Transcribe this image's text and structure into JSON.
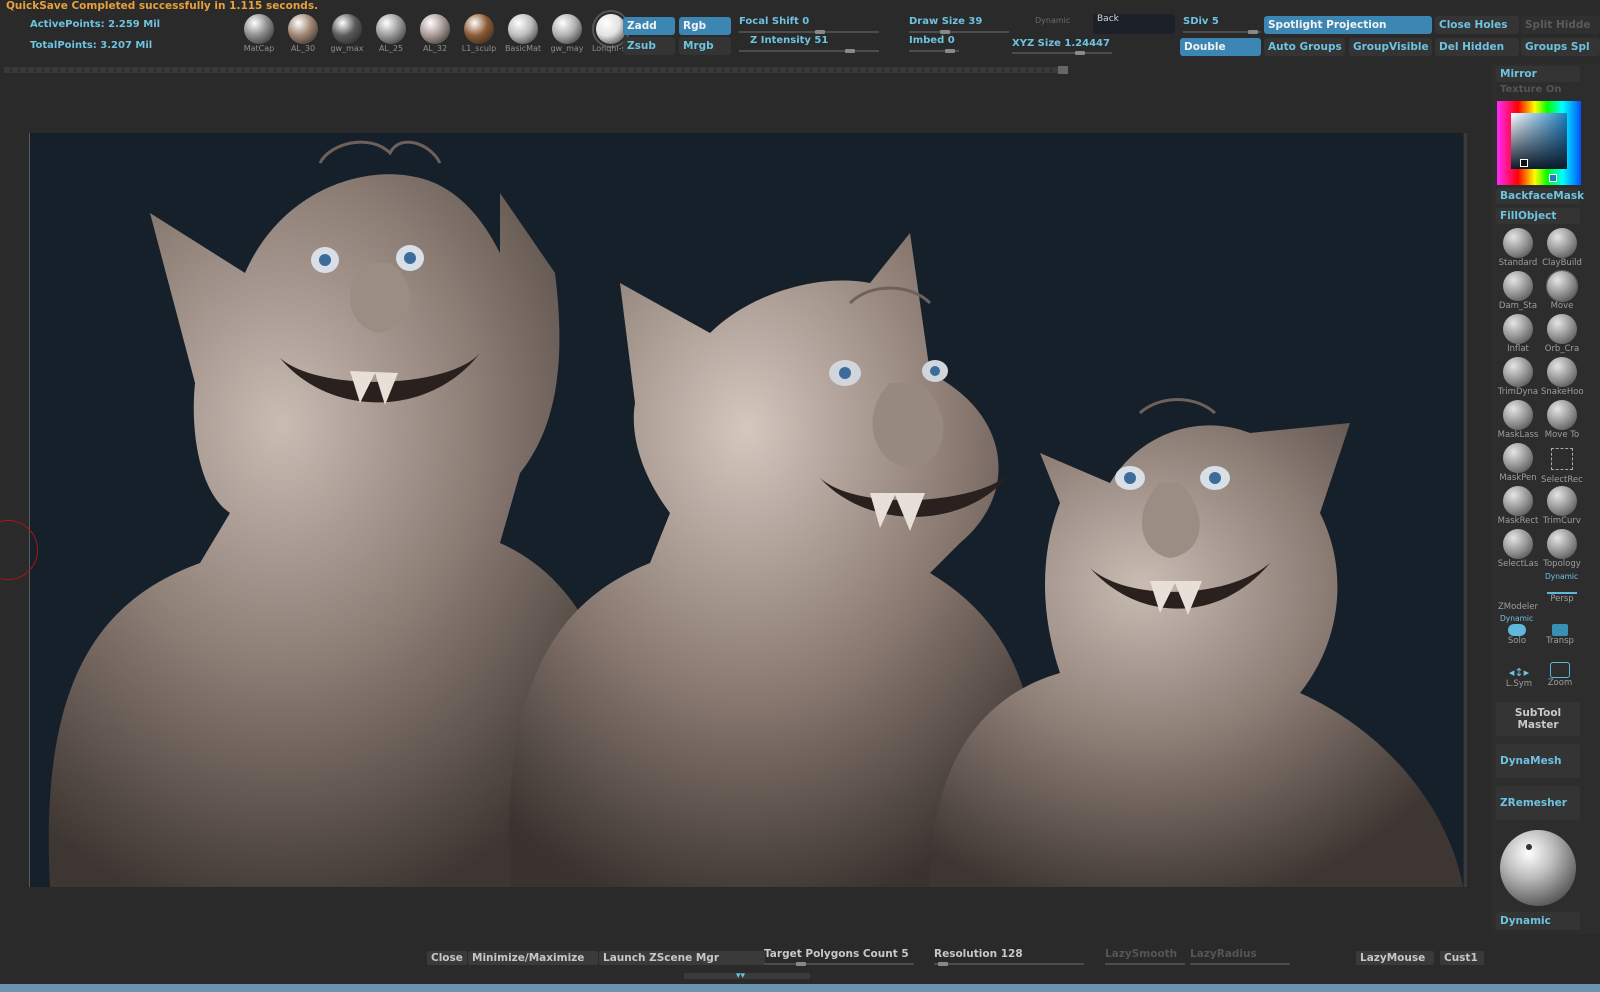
{
  "status": {
    "message": "QuickSave Completed successfully in 1.115 seconds.",
    "active_points": "ActivePoints: 2.259 Mil",
    "total_points": "TotalPoints: 3.207 Mil"
  },
  "materials": [
    {
      "label": "MatCap",
      "color": "#8c8c8c"
    },
    {
      "label": "AL_30",
      "color": "#a08470"
    },
    {
      "label": "gw_max",
      "color": "#5a5a5a"
    },
    {
      "label": "AL_25",
      "color": "#9a9a9a"
    },
    {
      "label": "AL_32",
      "color": "#a89a94"
    },
    {
      "label": "L1_sculp",
      "color": "#8b5a33"
    },
    {
      "label": "BasicMat",
      "color": "#bcbcbc"
    },
    {
      "label": "gw_may",
      "color": "#b0b0b0"
    },
    {
      "label": "Lonqhi-sc",
      "color": "#e2e2e2"
    }
  ],
  "toolbar": {
    "zadd": "Zadd",
    "zsub": "Zsub",
    "rgb": "Rgb",
    "mrgb": "Mrgb",
    "focal_shift": "Focal Shift 0",
    "z_intensity": "Z Intensity 51",
    "draw_size": "Draw Size 39",
    "imbed": "Imbed 0",
    "dynamic": "Dynamic",
    "back": "Back",
    "xyz_size": "XYZ Size 1.24447",
    "sdiv": "SDiv 5",
    "double": "Double",
    "spotlight": "Spotlight Projection",
    "auto_groups": "Auto Groups",
    "group_visible": "GroupVisible",
    "close_holes": "Close Holes",
    "del_hidden": "Del Hidden",
    "split_hidden": "Split Hidde",
    "groups_split": "Groups Spl"
  },
  "right_panel": {
    "mirror": "Mirror",
    "texture_on": "Texture On",
    "backface_mask": "BackfaceMask",
    "fill_object": "FillObject",
    "brushes": [
      "Standard",
      "ClayBuild",
      "Dam_Sta",
      "Move",
      "Inflat",
      "Orb_Cra",
      "TrimDyna",
      "SnakeHoo",
      "MaskLass",
      "Move To",
      "MaskPen",
      "SelectRec",
      "MaskRect",
      "TrimCurv",
      "SelectLas",
      "Topology",
      "ZModeler",
      "Persp"
    ],
    "dynamic_small": "Dynamic",
    "solo": "Solo",
    "transp": "Transp",
    "lsym": "L.Sym",
    "zoom": "Zoom",
    "subtool_master": "SubTool Master",
    "dynamesh": "DynaMesh",
    "zremesher": "ZRemesher",
    "dynamic": "Dynamic"
  },
  "bottom": {
    "close": "Close",
    "minimize": "Minimize/Maximize",
    "launch": "Launch ZScene Mgr",
    "target_polygons": "Target Polygons Count 5",
    "resolution": "Resolution 128",
    "lazy_smooth": "LazySmooth",
    "lazy_radius": "LazyRadius",
    "lazymouse": "LazyMouse",
    "cust1": "Cust1"
  },
  "colors": {
    "accent": "#3b86b3",
    "text_cyan": "#6ec3e0",
    "status_orange": "#e8a13a",
    "viewport_bg": "#15202a"
  }
}
